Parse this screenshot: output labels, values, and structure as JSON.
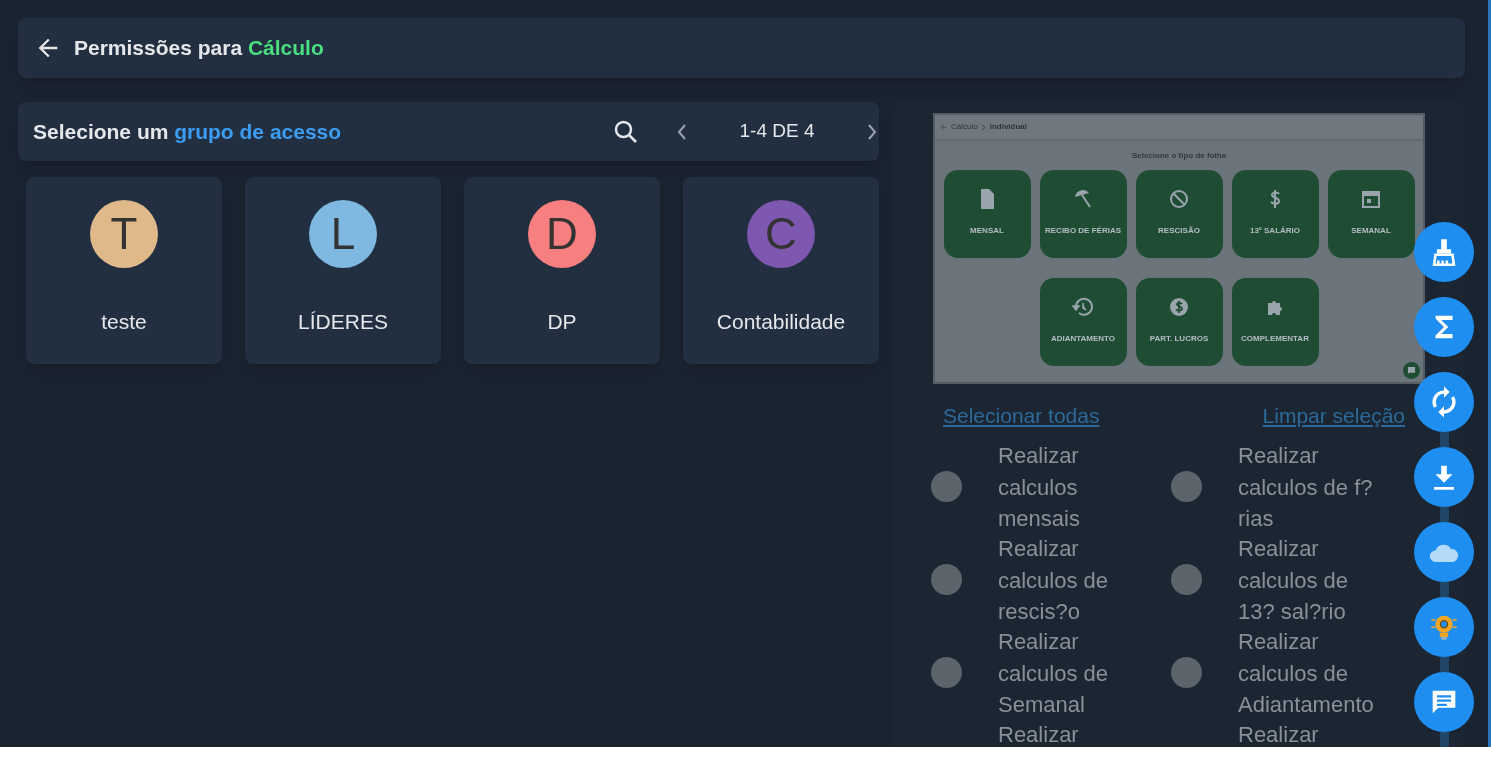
{
  "header": {
    "title_prefix": "Permissões para",
    "title_highlight": "Cálculo"
  },
  "group_bar": {
    "title_prefix": "Selecione um",
    "title_highlight": "grupo de acesso",
    "pagination": "1-4 DE 4"
  },
  "groups": [
    {
      "initial": "T",
      "name": "teste",
      "color": "#e0b98a"
    },
    {
      "initial": "L",
      "name": "LÍDERES",
      "color": "#7fb8e0"
    },
    {
      "initial": "D",
      "name": "DP",
      "color": "#f87f7f"
    },
    {
      "initial": "C",
      "name": "Contabilidade",
      "color": "#7e57b0"
    }
  ],
  "preview": {
    "breadcrumb": [
      "Cálculo",
      "Individual"
    ],
    "heading": "Selecione o tipo de folha",
    "tiles": [
      {
        "kind": "file",
        "label": "MENSAL"
      },
      {
        "kind": "umbrella",
        "label": "RECIBO DE FÉRIAS"
      },
      {
        "kind": "block",
        "label": "RESCISÃO"
      },
      {
        "kind": "dollar",
        "label": "13º SALÁRIO"
      },
      {
        "kind": "calendar",
        "label": "SEMANAL"
      },
      {
        "kind": "history",
        "label": "ADIANTAMENTO"
      },
      {
        "kind": "coin",
        "label": "PART. LUCROS"
      },
      {
        "kind": "puzzle",
        "label": "COMPLEMENTAR"
      }
    ]
  },
  "links": [
    "Selecionar todas",
    "Limpar seleção"
  ],
  "permissions": [
    {
      "label": "Realizar calculos mensais",
      "checked": false
    },
    {
      "label": "Realizar calculos de f?rias",
      "checked": false
    },
    {
      "label": "Realizar calculos de rescis?o",
      "checked": false
    },
    {
      "label": "Realizar calculos de 13? sal?rio",
      "checked": false
    },
    {
      "label": "Realizar calculos de Semanal",
      "checked": false
    },
    {
      "label": "Realizar calculos de Adiantamento",
      "checked": false
    },
    {
      "label": "Realizar"
    },
    {
      "label": "Realizar"
    }
  ],
  "fab_buttons": [
    {
      "kind": "brush"
    },
    {
      "kind": "sigma"
    },
    {
      "kind": "sync"
    },
    {
      "kind": "download"
    },
    {
      "kind": "cloud"
    },
    {
      "kind": "bulb"
    },
    {
      "kind": "chat"
    }
  ]
}
